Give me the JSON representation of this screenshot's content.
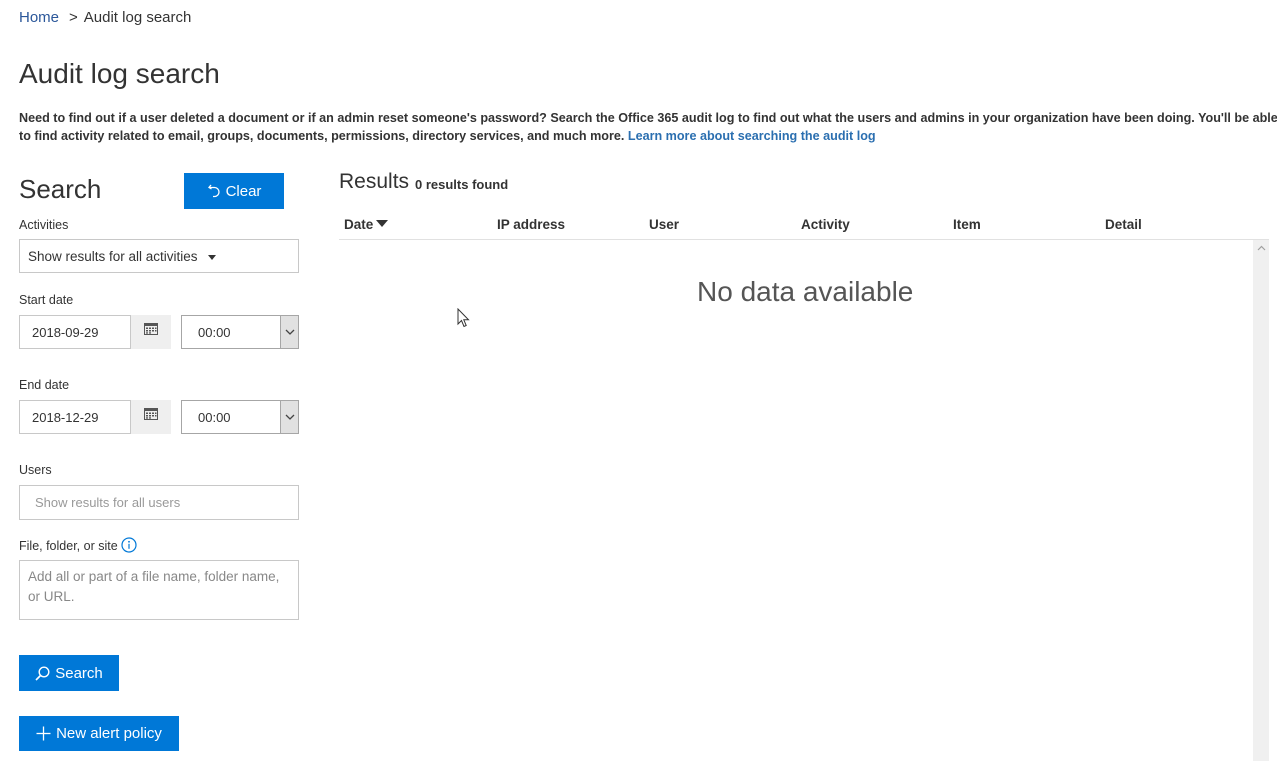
{
  "breadcrumb": {
    "home": "Home",
    "separator": ">",
    "current": "Audit log search"
  },
  "page_title": "Audit log search",
  "intro": {
    "text": "Need to find out if a user deleted a document or if an admin reset someone's password? Search the Office 365 audit log to find out what the users and admins in your organization have been doing. You'll be able to find activity related to email, groups, documents, permissions, directory services, and much more.",
    "link": "Learn more about searching the audit log"
  },
  "search_panel": {
    "heading": "Search",
    "clear_label": "Clear",
    "activities_label": "Activities",
    "activities_value": "Show results for all activities",
    "start_date_label": "Start date",
    "start_date_value": "2018-09-29",
    "start_time_value": "00:00",
    "end_date_label": "End date",
    "end_date_value": "2018-12-29",
    "end_time_value": "00:00",
    "users_label": "Users",
    "users_placeholder": "Show results for all users",
    "file_label": "File, folder, or site",
    "file_placeholder": "Add all or part of a file name, folder name, or URL.",
    "search_label": "Search",
    "new_alert_label": "New alert policy"
  },
  "results": {
    "heading": "Results",
    "count": "0 results found",
    "columns": [
      "Date",
      "IP address",
      "User",
      "Activity",
      "Item",
      "Detail"
    ],
    "empty_message": "No data available"
  },
  "colors": {
    "accent": "#0078d7",
    "link": "#2b6fb0"
  }
}
